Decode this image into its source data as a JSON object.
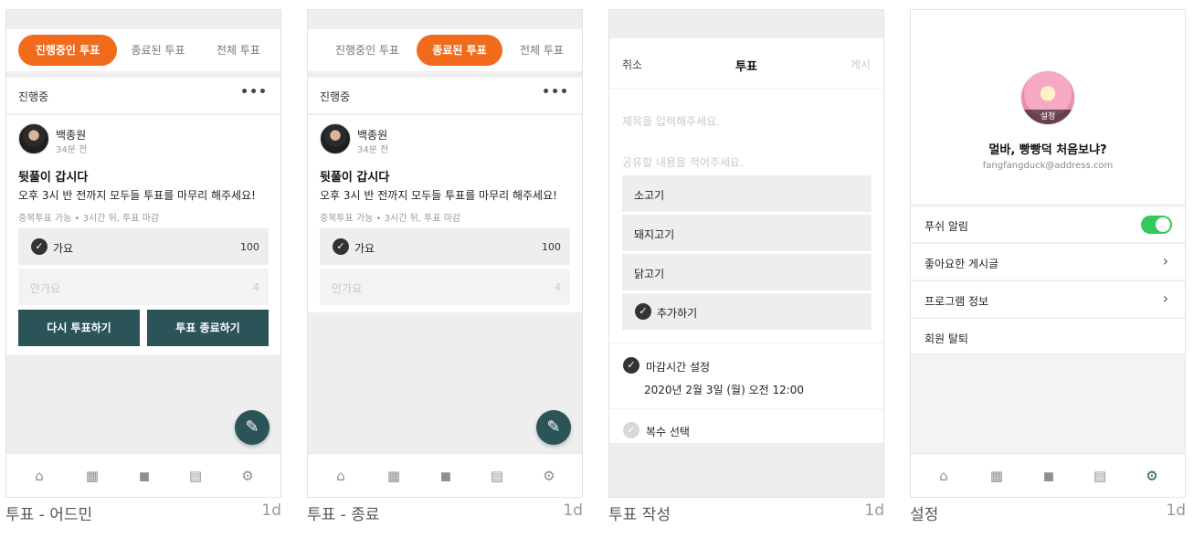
{
  "screens": [
    {
      "caption": "투표 - 어드민",
      "age": "1d",
      "tabs": [
        {
          "label": "진행중인 투표",
          "active": true
        },
        {
          "label": "종료된 투표",
          "active": false
        },
        {
          "label": "전체 투표",
          "active": false
        }
      ],
      "section_title": "진행중",
      "more": "•••",
      "post": {
        "author": "백종원",
        "time": "34분 전",
        "title": "뒷풀이 갑시다",
        "body": "오후 3시 반 전까지 모두들 투표를 마무리 해주세요!",
        "meta": "중복투표 가능 • 3시간 뒤, 투표 마감",
        "options": [
          {
            "label": "가요",
            "count": "100",
            "selected": true
          },
          {
            "label": "안가요",
            "count": "4",
            "selected": false
          }
        ],
        "buttons": [
          "다시 투표하기",
          "투표 종료하기"
        ]
      }
    },
    {
      "caption": "투표 - 종료",
      "age": "1d",
      "tabs": [
        {
          "label": "진행중인 투표",
          "active": false
        },
        {
          "label": "종료된 투표",
          "active": true
        },
        {
          "label": "전체 투표",
          "active": false
        }
      ],
      "section_title": "진행중",
      "more": "•••",
      "post": {
        "author": "백종원",
        "time": "34분 전",
        "title": "뒷풀이 갑시다",
        "body": "오후 3시 반 전까지 모두들 투표를 마무리 해주세요!",
        "meta": "중복투표 가능 • 3시간 뒤, 투표 마감",
        "options": [
          {
            "label": "가요",
            "count": "100",
            "selected": true
          },
          {
            "label": "안가요",
            "count": "4",
            "selected": false
          }
        ]
      }
    },
    {
      "caption": "투표 작성",
      "age": "1d",
      "header": {
        "cancel": "취소",
        "title": "투표",
        "post": "게시"
      },
      "title_placeholder": "제목을 입력해주세요.",
      "content_placeholder": "공유할 내용을 적어주세요.",
      "options": [
        "소고기",
        "돼지고기",
        "닭고기"
      ],
      "add_option": "추가하기",
      "deadline_label": "마감시간 설정",
      "deadline_value": "2020년 2월 3일 (월) 오전 12:00",
      "multi_label": "복수 선택"
    },
    {
      "caption": "설정",
      "age": "1d",
      "avatar_badge": "설정",
      "name": "멀바, 빵빵덕 처음보냐?",
      "email": "fangfangduck@address.com",
      "push_label": "푸쉬 알림",
      "push_on": true,
      "rows": [
        "좋아요한 게시글",
        "프로그램 정보",
        "회원 탈퇴"
      ]
    }
  ],
  "icons": {
    "check": "✓",
    "chevron": "›",
    "fab": "✎",
    "nav": [
      "home-icon",
      "calendar-icon",
      "bag-icon",
      "document-icon",
      "gear-icon"
    ]
  },
  "colors": {
    "accent_orange": "#f26b1d",
    "primary_teal": "#2b5458",
    "toggle_green": "#34c759"
  }
}
